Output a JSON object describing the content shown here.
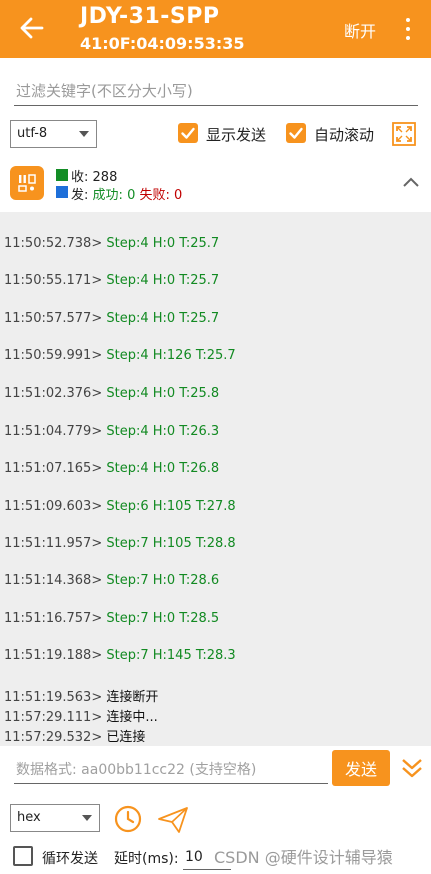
{
  "header": {
    "title": "JDY-31-SPP",
    "address": "41:0F:04:09:53:35",
    "disconnect_label": "断开",
    "bg_color": "#f7931e"
  },
  "filter": {
    "placeholder": "过滤关键字(不区分大小写)"
  },
  "options": {
    "encoding": "utf-8",
    "show_send_label": "显示发送",
    "show_send_checked": true,
    "auto_scroll_label": "自动滚动",
    "auto_scroll_checked": true
  },
  "stats": {
    "recv_label": "收:",
    "recv_count": "288",
    "send_label": "发:",
    "success_label": "成功:",
    "success_count": "0",
    "fail_label": "失败:",
    "fail_count": "0"
  },
  "log": [
    {
      "time": "11:50:52.738>",
      "text": "Step:4 H:0 T:25.7",
      "kind": "data"
    },
    {
      "time": "11:50:55.171>",
      "text": "Step:4 H:0 T:25.7",
      "kind": "data"
    },
    {
      "time": "11:50:57.577>",
      "text": "Step:4 H:0 T:25.7",
      "kind": "data"
    },
    {
      "time": "11:50:59.991>",
      "text": "Step:4 H:126 T:25.7",
      "kind": "data"
    },
    {
      "time": "11:51:02.376>",
      "text": "Step:4 H:0 T:25.8",
      "kind": "data"
    },
    {
      "time": "11:51:04.779>",
      "text": "Step:4 H:0 T:26.3",
      "kind": "data"
    },
    {
      "time": "11:51:07.165>",
      "text": "Step:4 H:0 T:26.8",
      "kind": "data"
    },
    {
      "time": "11:51:09.603>",
      "text": "Step:6 H:105 T:27.8",
      "kind": "data"
    },
    {
      "time": "11:51:11.957>",
      "text": "Step:7 H:105 T:28.8",
      "kind": "data"
    },
    {
      "time": "11:51:14.368>",
      "text": "Step:7 H:0 T:28.6",
      "kind": "data"
    },
    {
      "time": "11:51:16.757>",
      "text": "Step:7 H:0 T:28.5",
      "kind": "data"
    },
    {
      "time": "11:51:19.188>",
      "text": "Step:7 H:145 T:28.3",
      "kind": "data"
    },
    {
      "time": "11:51:19.563>",
      "text": "连接断开",
      "kind": "msg"
    },
    {
      "time": "11:57:29.111>",
      "text": "连接中...",
      "kind": "msg"
    },
    {
      "time": "11:57:29.532>",
      "text": "已连接",
      "kind": "msg"
    }
  ],
  "send": {
    "placeholder": "数据格式: aa00bb11cc22 (支持空格)",
    "send_label": "发送",
    "format": "hex",
    "loop_label": "循环发送",
    "loop_checked": false,
    "delay_label": "延时(ms):",
    "delay_value": "10"
  },
  "watermark": "CSDN @硬件设计辅导猿",
  "colors": {
    "accent": "#f7931e",
    "recv": "#138d26",
    "send": "#1e6fd9",
    "fail": "#c00000",
    "data_text": "#128a22"
  }
}
